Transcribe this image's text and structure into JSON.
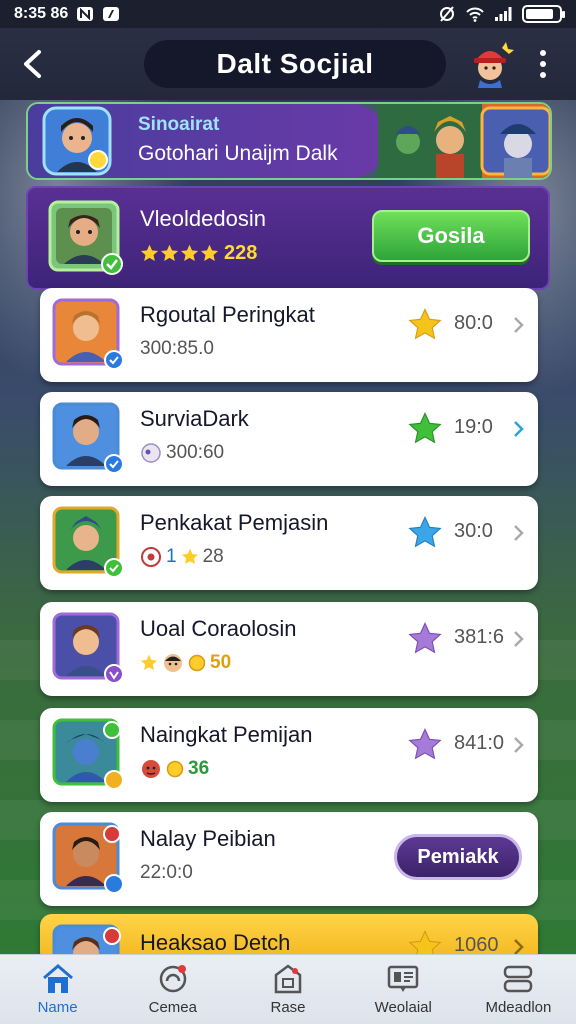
{
  "status_bar": {
    "time": "8:35 86",
    "battery_level": 0.85
  },
  "header": {
    "title": "Dalt Socjial",
    "back_icon": "chevron-left-icon",
    "more_icon": "more-vertical-icon"
  },
  "banner": {
    "title": "Sinoairat",
    "subtitle": "Gotohari Unaijm Dalk"
  },
  "featured": {
    "name": "Vleoldedosin",
    "stars": 4,
    "score": "228",
    "button_label": "Gosila"
  },
  "rows": [
    {
      "name": "Rgoutal Peringkat",
      "sub": "300:85.0",
      "score": "80:0",
      "star_color": "#f4c41a",
      "badge": "blue",
      "frame": "#a06ad8"
    },
    {
      "name": "SurviaDark",
      "sub": "300:60",
      "score": "19:0",
      "star_color": "#3fbf3a",
      "badge": "blue",
      "frame": "#4a8bd8",
      "chevron_color": "#2aa3d6"
    },
    {
      "name": "Penkakat Pemjasin",
      "sub_a": "1",
      "sub_b": "28",
      "score": "30:0",
      "star_color": "#3aa6e8",
      "badge": "green",
      "frame": "#e0a92a"
    },
    {
      "name": "Uoal Coraolosin",
      "sub": "50",
      "score": "381:6",
      "star_color": "#a67ad8",
      "badge": "purple",
      "frame": "#a06ad8"
    },
    {
      "name": "Naingkat Pemijan",
      "sub": "36",
      "score": "841:0",
      "star_color": "#a67ad8",
      "badge": "green",
      "frame": "#3fbf3a"
    },
    {
      "name": "Nalay Peibian",
      "sub": "22:0:0",
      "button_label": "Pemiakk",
      "badge": "blue",
      "frame": "#4a8bd8"
    },
    {
      "name": "Heaksao Detch",
      "score": "1060",
      "star_color": "#f4c41a",
      "frame": "#4a8bd8"
    }
  ],
  "bottom_nav": [
    {
      "label": "Name",
      "icon": "home-icon",
      "active": true
    },
    {
      "label": "Cemea",
      "icon": "notification-icon",
      "active": false
    },
    {
      "label": "Rase",
      "icon": "shop-icon",
      "active": false
    },
    {
      "label": "Weolaial",
      "icon": "social-icon",
      "active": false
    },
    {
      "label": "Mdeadlon",
      "icon": "menu-icon",
      "active": false
    }
  ],
  "colors": {
    "accent": "#1f6fd0",
    "primary_button": "#2ea43a",
    "purple": "#5a2f95"
  }
}
